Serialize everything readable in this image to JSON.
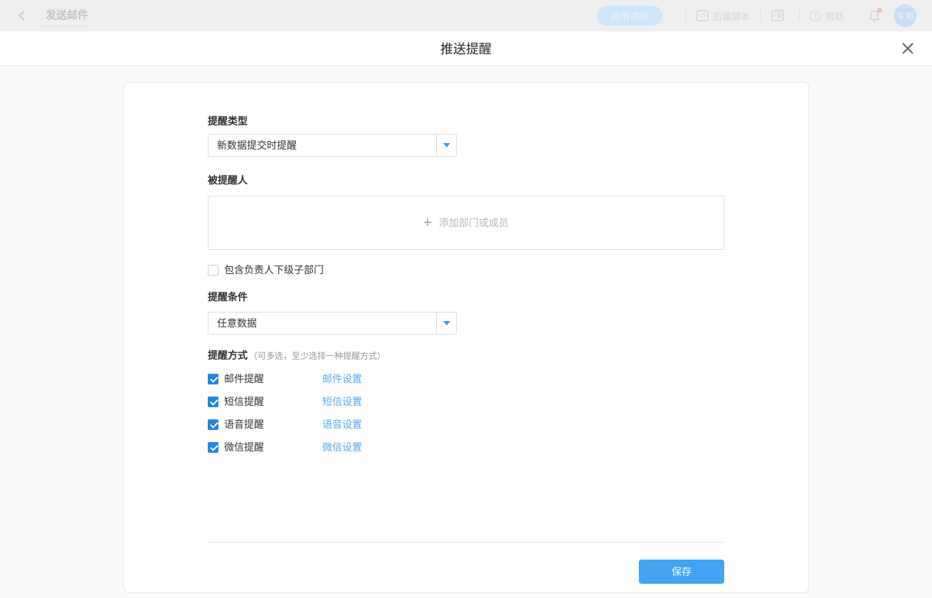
{
  "topbar": {
    "back_label": "发送邮件",
    "app_access_label": "应用访问",
    "backend_script_label": "后端脚本",
    "help_label": "帮助",
    "avatar_label": "专用"
  },
  "modal": {
    "title": "推送提醒"
  },
  "form": {
    "reminder_type": {
      "label": "提醒类型",
      "value": "新数据提交时提醒"
    },
    "reminded_people": {
      "label": "被提醒人",
      "add_placeholder": "添加部门或成员",
      "plus_sign": "+",
      "include_sub_label": "包含负责人下级子部门",
      "include_sub_checked": false
    },
    "condition": {
      "label": "提醒条件",
      "value": "任意数据"
    },
    "methods": {
      "label": "提醒方式",
      "note": "（可多选，至少选择一种提醒方式）",
      "items": [
        {
          "label": "邮件提醒",
          "link": "邮件设置",
          "checked": true
        },
        {
          "label": "短信提醒",
          "link": "短信设置",
          "checked": true
        },
        {
          "label": "语音提醒",
          "link": "语音设置",
          "checked": true
        },
        {
          "label": "微信提醒",
          "link": "微信设置",
          "checked": true
        }
      ]
    },
    "save_label": "保存"
  },
  "colors": {
    "accent_blue": "#42a3f5",
    "checkbox_blue": "#2086e8",
    "link_blue": "#55a8f0",
    "caret_blue": "#3b9cf0",
    "notification_dot": "#f3bcb8"
  }
}
